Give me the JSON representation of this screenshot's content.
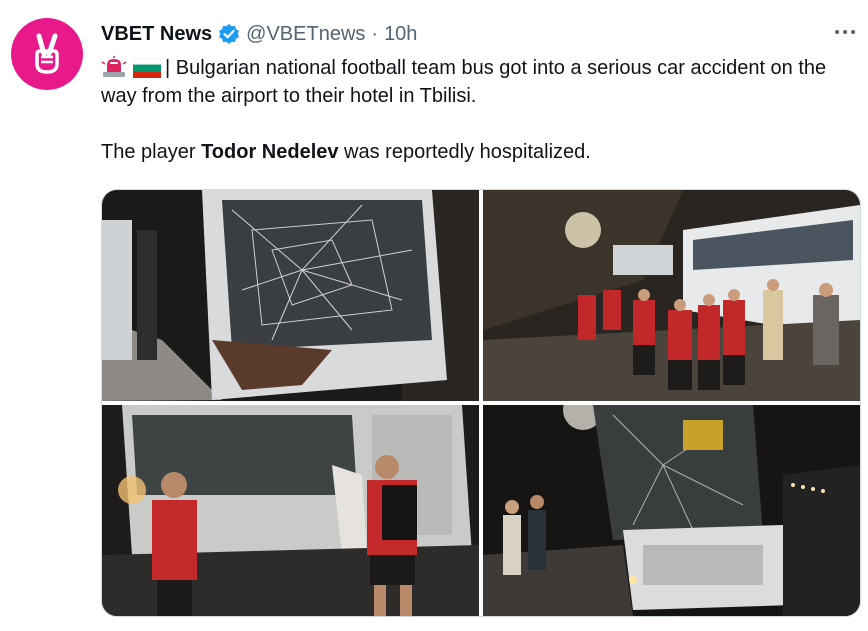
{
  "account": {
    "display_name": "VBET News",
    "handle": "@VBETnews",
    "separator": "·",
    "timestamp": "10h",
    "verified": true,
    "avatar_color": "#e8198b"
  },
  "tweet": {
    "emojis": [
      "police-light-emoji",
      "bulgaria-flag-emoji"
    ],
    "line1_text": "| Bulgarian national football team bus got into a serious car accident on the way from the airport to their hotel in Tbilisi.",
    "line2_prefix": "The player ",
    "line2_bold": "Todor Nedelev",
    "line2_suffix": " was reportedly hospitalized."
  },
  "media": {
    "photos": [
      {
        "name": "photo-bus-damaged-windshield"
      },
      {
        "name": "photo-players-beside-bus"
      },
      {
        "name": "photo-players-walking-by-bus"
      },
      {
        "name": "photo-bus-front-night"
      }
    ]
  },
  "colors": {
    "text": "#0f1419",
    "secondary": "#536471",
    "verified_blue": "#1d9bf0",
    "border": "#cfd9de"
  }
}
